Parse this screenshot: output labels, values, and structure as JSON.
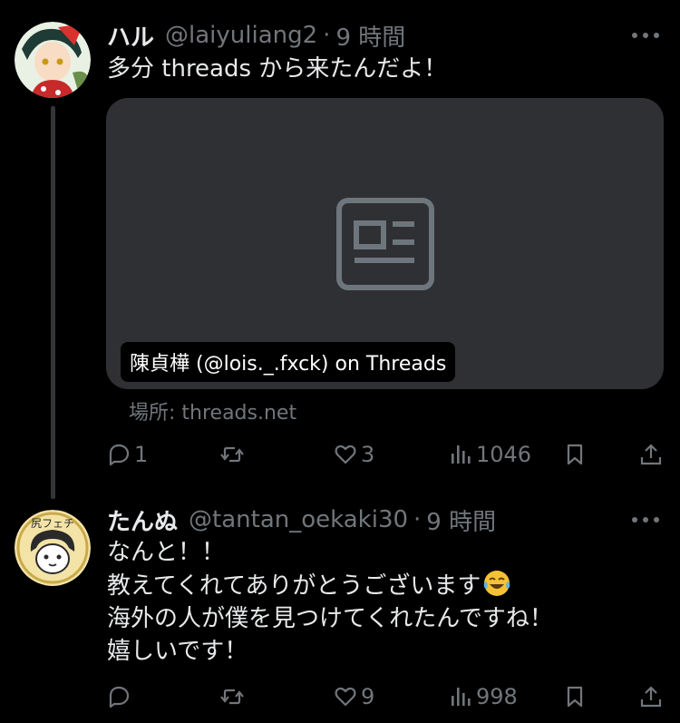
{
  "post1": {
    "display_name": "ハル",
    "handle": "@laiyuliang2",
    "separator": "·",
    "time": "9 時間",
    "text_lines": [
      "多分 threads から来たんだよ！"
    ],
    "card": {
      "title": "陳貞樺 (@lois._.fxck) on Threads",
      "source": "場所: threads.net",
      "icon": "article-icon"
    },
    "actions": {
      "replies": "1",
      "reposts": "",
      "likes": "3",
      "views": "1046"
    }
  },
  "post2": {
    "display_name": "たんぬ",
    "handle": "@tantan_oekaki30",
    "separator": "·",
    "time": "9 時間",
    "text_lines": [
      "なんと！！",
      "教えてくれてありがとうございます",
      "海外の人が僕を見つけてくれたんですね！",
      "嬉しいです！"
    ],
    "emoji": "tears-of-joy-emoji",
    "avatar_text": "尻フェチ",
    "actions": {
      "replies": "",
      "reposts": "",
      "likes": "9",
      "views": "998"
    }
  },
  "colors": {
    "background": "#000000",
    "text": "#e7e9ea",
    "secondary": "#71767b",
    "card": "#2f3033",
    "thread_line": "#333639"
  }
}
